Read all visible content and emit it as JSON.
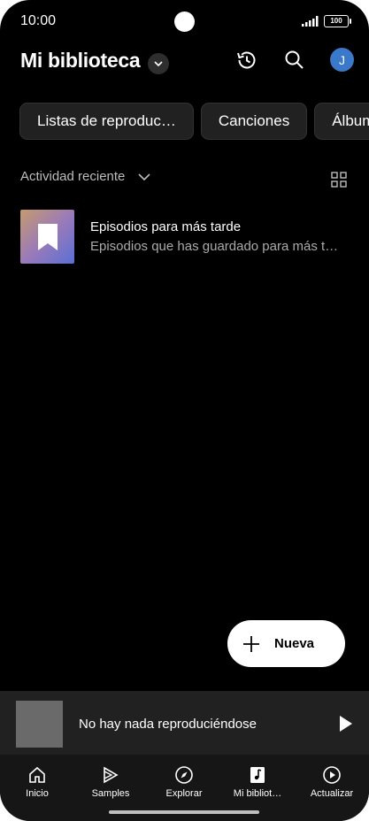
{
  "status": {
    "time": "10:00",
    "battery": "100"
  },
  "header": {
    "title": "Mi biblioteca",
    "avatar_initial": "J"
  },
  "chips": [
    "Listas de reproduc…",
    "Canciones",
    "Álbum"
  ],
  "sort": {
    "label": "Actividad reciente"
  },
  "items": [
    {
      "title": "Episodios para más tarde",
      "subtitle": "Episodios que has guardado para más t…"
    }
  ],
  "fab": {
    "label": "Nueva"
  },
  "miniplayer": {
    "text": "No hay nada reproduciéndose"
  },
  "nav": [
    "Inicio",
    "Samples",
    "Explorar",
    "Mi bibliot…",
    "Actualizar"
  ],
  "colors": {
    "background": "#000000",
    "avatar": "#3a78c9",
    "chip": "#212121",
    "miniplayer": "#212121"
  }
}
